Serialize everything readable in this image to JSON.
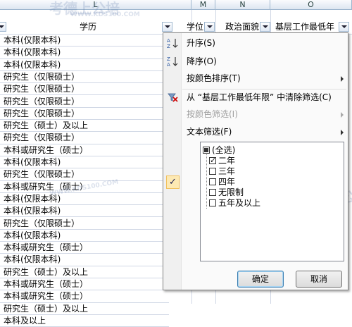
{
  "columns": {
    "L": "L",
    "M": "M",
    "N": "N",
    "O": "O"
  },
  "header": {
    "education": "学历",
    "degree": "学位",
    "politics": "政治面貌",
    "experience": "基层工作最低年"
  },
  "rows": [
    "本科(仅限本科)",
    "本科(仅限本科)",
    "本科(仅限本科)",
    "研究生（仅限硕士）",
    "研究生（仅限硕士）",
    "研究生（仅限硕士）",
    "研究生（仅限硕士）",
    "研究生（硕士）及以上",
    "研究生（仅限硕士）",
    "本科或研究生（硕士）",
    "本科(仅限本科)",
    "研究生（仅限硕士）",
    "本科或研究生（硕士）",
    "本科(仅限本科)",
    "本科(仅限本科)",
    "研究生（仅限硕士）",
    "本科(仅限本科)",
    "本科或研究生（硕士）",
    "本科(仅限本科)",
    "研究生（硕士）及以上",
    "本科或研究生（硕士）",
    "本科或研究生（硕士）",
    "研究生（硕士）及以上",
    "本科及以上"
  ],
  "row_edge_fragments": [
    "",
    "",
    "",
    "",
    "",
    "",
    "",
    "",
    "",
    "",
    "",
    "",
    "",
    "",
    "",
    "",
    "",
    "",
    "",
    "",
    "",
    "",
    "",
    ""
  ],
  "menu": {
    "sort_asc": "升序(S)",
    "sort_desc": "降序(O)",
    "sort_color": "按颜色排序(T)",
    "clear_filter": "从 “基层工作最低年限” 中清除筛选(C)",
    "filter_color": "按颜色筛选(I)",
    "text_filter": "文本筛选(F)",
    "list": [
      {
        "label": "(全选)",
        "state": "partial"
      },
      {
        "label": "二年",
        "state": "checked"
      },
      {
        "label": "三年",
        "state": "unchecked"
      },
      {
        "label": "四年",
        "state": "unchecked"
      },
      {
        "label": "无限制",
        "state": "unchecked"
      },
      {
        "label": "五年及以上",
        "state": "unchecked"
      }
    ],
    "ok": "确定",
    "cancel": "取消"
  },
  "watermark": {
    "brand": "考德上公培",
    "site": "WWW.KDS100.COM"
  },
  "colors": {
    "accent": "#3c7fb1",
    "highlight": "#fde9b3",
    "grid": "#d0d7e5"
  }
}
